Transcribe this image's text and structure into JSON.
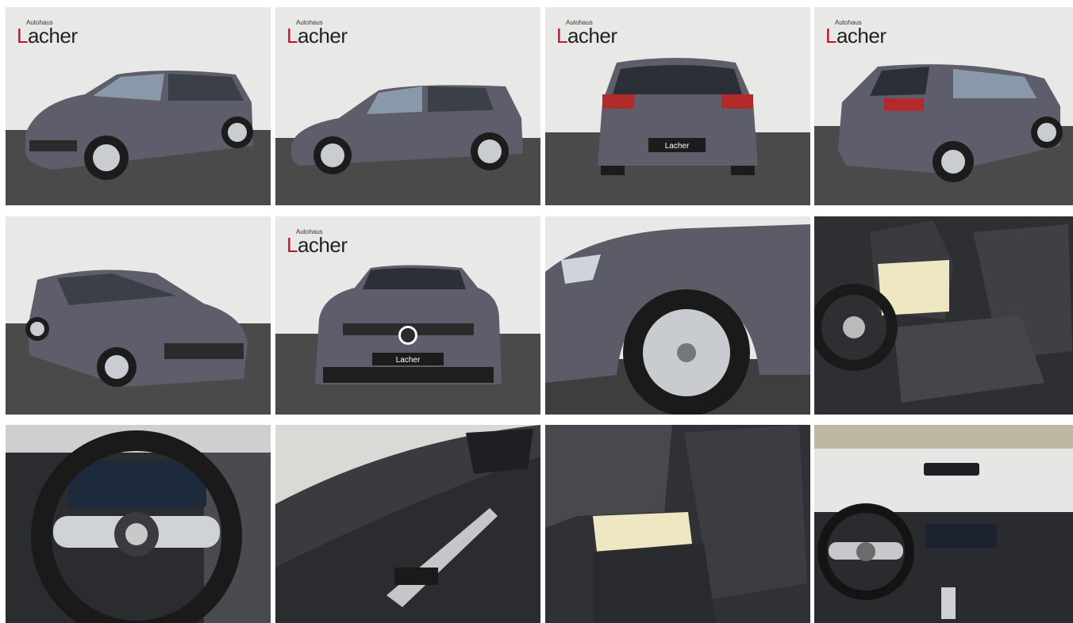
{
  "dealer": {
    "logo_small": "Autohaus",
    "logo_first_letter": "L",
    "logo_rest": "acher",
    "brand_color": "#c8102e"
  },
  "plate_text": "Lacher",
  "gallery": {
    "tiles": [
      {
        "label": "Front three-quarter view, left"
      },
      {
        "label": "Side profile"
      },
      {
        "label": "Rear view"
      },
      {
        "label": "Rear three-quarter view, right"
      },
      {
        "label": "Front three-quarter view, right"
      },
      {
        "label": "Front view"
      },
      {
        "label": "Front wheel detail"
      },
      {
        "label": "Driver seat interior"
      },
      {
        "label": "Steering wheel and cockpit"
      },
      {
        "label": "Door panel detail"
      },
      {
        "label": "Rear seats"
      },
      {
        "label": "Dashboard overview"
      }
    ]
  }
}
